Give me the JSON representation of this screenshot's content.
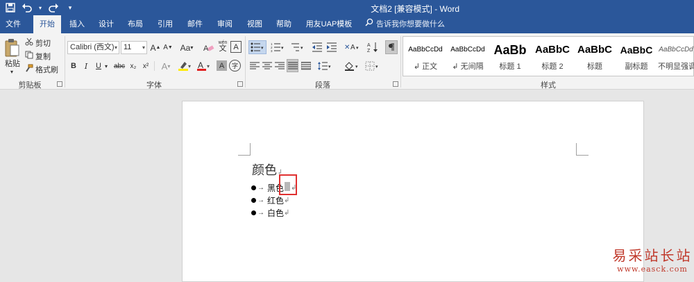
{
  "title_bar": {
    "window_title": "文档2 [兼容模式] - Word",
    "qat": {
      "save_icon": "save-icon",
      "undo_icon": "undo-icon",
      "redo_icon": "redo-icon",
      "customize_icon": "customize-qat-icon"
    }
  },
  "tabs": [
    "文件",
    "开始",
    "插入",
    "设计",
    "布局",
    "引用",
    "邮件",
    "审阅",
    "视图",
    "帮助",
    "用友UAP模板"
  ],
  "active_tab": "开始",
  "tell_me": "告诉我你想要做什么",
  "clipboard": {
    "paste": "粘贴",
    "cut": "剪切",
    "copy": "复制",
    "format_painter": "格式刷",
    "label": "剪贴板"
  },
  "font": {
    "font_name": "Calibri (西文)",
    "font_size": "11",
    "case_label": "Aa",
    "phonetic": "wén",
    "bold": "B",
    "italic": "I",
    "underline": "U",
    "strike": "abc",
    "subscript": "x₂",
    "superscript": "x²",
    "label": "字体"
  },
  "paragraph": {
    "label": "段落"
  },
  "styles": {
    "label": "样式",
    "items": [
      {
        "preview": "AaBbCcDd",
        "name": "↲ 正文"
      },
      {
        "preview": "AaBbCcDd",
        "name": "↲ 无间隔"
      },
      {
        "preview": "AaBb",
        "name": "标题 1"
      },
      {
        "preview": "AaBbC",
        "name": "标题 2"
      },
      {
        "preview": "AaBbC",
        "name": "标题"
      },
      {
        "preview": "AaBbC",
        "name": "副标题"
      },
      {
        "preview": "AaBbCcDd",
        "name": "不明显强调"
      }
    ]
  },
  "document": {
    "heading": "颜色",
    "paragraph_mark": "↲",
    "items": [
      "黑色",
      "红色",
      "白色"
    ],
    "arrow": "→"
  },
  "watermark": {
    "line1": "易采站长站",
    "line2": "www.easck.com"
  },
  "colors": {
    "brand": "#2b579a",
    "highlight": "#e03030"
  }
}
